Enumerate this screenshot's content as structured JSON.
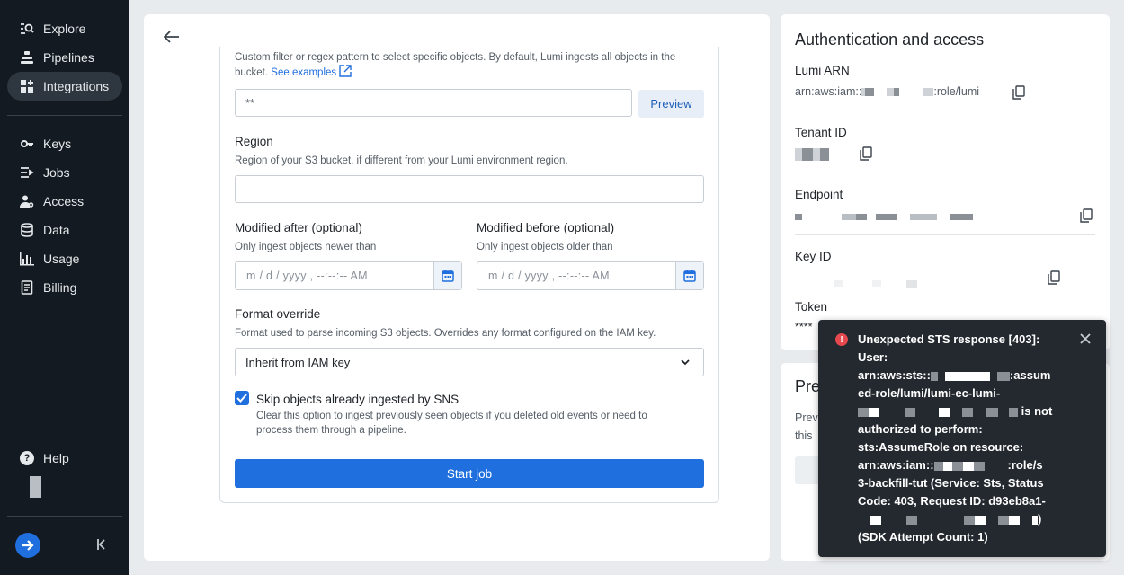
{
  "sidebar": {
    "items": [
      {
        "label": "Explore",
        "icon": "explore-icon"
      },
      {
        "label": "Pipelines",
        "icon": "pipelines-icon"
      },
      {
        "label": "Integrations",
        "icon": "integrations-icon",
        "active": true
      },
      {
        "label": "Keys",
        "icon": "key-icon"
      },
      {
        "label": "Jobs",
        "icon": "jobs-icon"
      },
      {
        "label": "Access",
        "icon": "access-icon"
      },
      {
        "label": "Data",
        "icon": "database-icon"
      },
      {
        "label": "Usage",
        "icon": "chart-icon"
      },
      {
        "label": "Billing",
        "icon": "billing-icon"
      }
    ],
    "help_label": "Help"
  },
  "form": {
    "filter_help": "Custom filter or regex pattern to select specific objects. By default, Lumi ingests all objects in the bucket.",
    "filter_link": "See examples",
    "filter_value": "**",
    "preview_button": "Preview",
    "region_label": "Region",
    "region_help": "Region of your S3 bucket, if different from your Lumi environment region.",
    "region_value": "",
    "modified_after_label": "Modified after (optional)",
    "modified_after_help": "Only ingest objects newer than",
    "modified_after_placeholder": "m / d / yyyy ,  --:--:-- AM",
    "modified_before_label": "Modified before (optional)",
    "modified_before_help": "Only ingest objects older than",
    "modified_before_placeholder": "m / d / yyyy ,  --:--:-- AM",
    "format_label": "Format override",
    "format_help": "Format used to parse incoming S3 objects. Overrides any format configured on the IAM key.",
    "format_value": "Inherit from IAM key",
    "skip_label": "Skip objects already ingested by SNS",
    "skip_help": "Clear this option to ingest previously seen objects if you deleted old events or need to process them through a pipeline.",
    "skip_checked": true,
    "start_button": "Start job"
  },
  "auth": {
    "title": "Authentication and access",
    "arn_label": "Lumi ARN",
    "arn_prefix": "arn:aws:iam::",
    "arn_suffix": ":role/lumi",
    "tenant_label": "Tenant ID",
    "endpoint_label": "Endpoint",
    "keyid_label": "Key ID",
    "token_label": "Token",
    "token_value": "****"
  },
  "preview_card": {
    "title": "Pre",
    "line1": "Prev",
    "line2": "this"
  },
  "toast": {
    "line1": "Unexpected STS response [403]:",
    "line2": "User:",
    "line3a": "arn:aws:sts::",
    "line3b": ":assum",
    "line4": "ed-role/lumi/lumi-ec-lumi-",
    "line5b": "is not",
    "line6": "authorized to perform:",
    "line7": "sts:AssumeRole on resource:",
    "line8a": "arn:aws:iam::",
    "line8b": ":role/s",
    "line9": "3-backfill-tut (Service: Sts, Status",
    "line10": "Code: 403, Request ID: d93eb8a1-",
    "line11b": ")",
    "line12": "(SDK Attempt Count: 1)"
  },
  "colors": {
    "sidebar_bg": "#141a21",
    "accent": "#1f6fde",
    "toast_bg": "#23292f",
    "error": "#e5484d"
  }
}
